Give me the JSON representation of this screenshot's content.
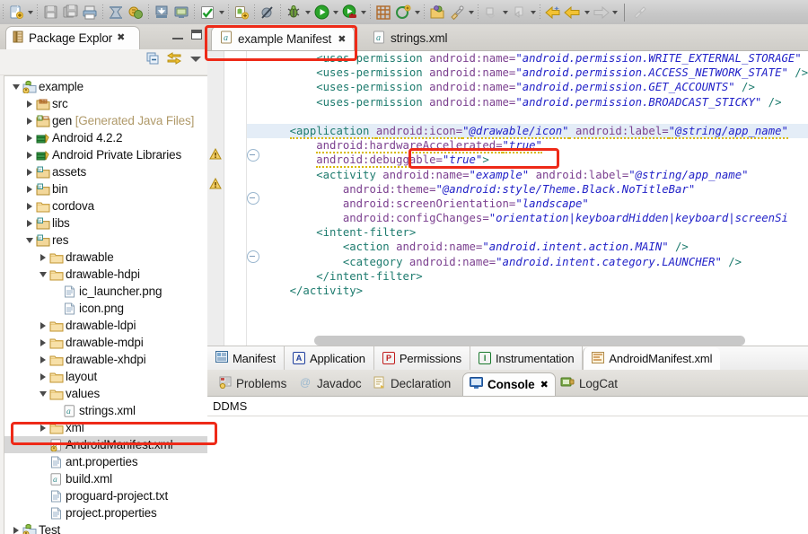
{
  "toolbar": {
    "buttons": [
      {
        "name": "new-wizard-icon",
        "label": "New",
        "dropdown": true
      },
      {
        "name": "save-icon",
        "label": "Save",
        "dropdown": false
      },
      {
        "name": "save-all-icon",
        "label": "Save All",
        "dropdown": false
      },
      {
        "name": "print-icon",
        "label": "Print",
        "dropdown": false
      },
      {
        "name": "android-sdk-manager-icon",
        "label": "Android SDK Manager",
        "dropdown": false
      },
      {
        "name": "android-virtual-device-manager-icon",
        "label": "Android Virtual Device Manager",
        "dropdown": false
      },
      {
        "name": "import-icon",
        "label": "Import",
        "dropdown": false
      },
      {
        "name": "export-icon",
        "label": "Export",
        "dropdown": false
      },
      {
        "name": "check-icon",
        "label": "Toggle Mark Occurrences",
        "dropdown": true
      },
      {
        "name": "new-android-project-icon",
        "label": "New Android Project",
        "dropdown": false
      },
      {
        "name": "skip-breakpoints-icon",
        "label": "Skip All Breakpoints",
        "dropdown": false
      },
      {
        "name": "debug-icon",
        "label": "Debug",
        "dropdown": true
      },
      {
        "name": "run-icon",
        "label": "Run",
        "dropdown": true
      },
      {
        "name": "run-external-tools-icon",
        "label": "External Tools",
        "dropdown": true
      },
      {
        "name": "new-java-package-icon",
        "label": "New Java Package",
        "dropdown": false
      },
      {
        "name": "new-java-class-icon",
        "label": "New Java Class",
        "dropdown": true
      },
      {
        "name": "open-type-icon",
        "label": "Open Type",
        "dropdown": false
      },
      {
        "name": "search-icon",
        "label": "Search",
        "dropdown": true
      },
      {
        "name": "next-annotation-icon",
        "label": "Next Annotation",
        "dropdown": true
      },
      {
        "name": "previous-annotation-icon",
        "label": "Previous Annotation",
        "dropdown": true
      },
      {
        "name": "back-icon",
        "label": "Back",
        "dropdown": false
      },
      {
        "name": "previous-edit-icon",
        "label": "Previous Edit Location",
        "dropdown": true
      },
      {
        "name": "forward-icon",
        "label": "Forward",
        "dropdown": true
      },
      {
        "name": "pin-editor-icon",
        "label": "Pin Editor",
        "dropdown": false
      }
    ]
  },
  "package_explorer": {
    "tab_title": "Package Explor",
    "close_glyph": "✖",
    "view_menu_glyph": "▽",
    "toolbar_icons": [
      "collapse-all-icon",
      "link-with-editor-icon",
      "view-menu-icon"
    ],
    "tree": [
      {
        "label": "example",
        "icon": "android-project-icon",
        "indent": 0,
        "twisty": "down"
      },
      {
        "label": "src",
        "icon": "source-folder-icon",
        "indent": 1,
        "twisty": "right"
      },
      {
        "label": "gen ",
        "icon": "gen-folder-icon",
        "indent": 1,
        "twisty": "right",
        "suffix": "[Generated Java Files]"
      },
      {
        "label": "Android 4.2.2",
        "icon": "library-icon",
        "indent": 1,
        "twisty": "right"
      },
      {
        "label": "Android Private Libraries",
        "icon": "library-icon",
        "indent": 1,
        "twisty": "right"
      },
      {
        "label": "assets",
        "icon": "res-folder-icon",
        "indent": 1,
        "twisty": "right"
      },
      {
        "label": "bin",
        "icon": "res-folder-icon",
        "indent": 1,
        "twisty": "right"
      },
      {
        "label": "cordova",
        "icon": "plain-folder-icon",
        "indent": 1,
        "twisty": "right"
      },
      {
        "label": "libs",
        "icon": "res-folder-icon",
        "indent": 1,
        "twisty": "right"
      },
      {
        "label": "res",
        "icon": "res-folder-icon",
        "indent": 1,
        "twisty": "down"
      },
      {
        "label": "drawable",
        "icon": "plain-folder-icon",
        "indent": 2,
        "twisty": "right"
      },
      {
        "label": "drawable-hdpi",
        "icon": "plain-folder-icon",
        "indent": 2,
        "twisty": "down"
      },
      {
        "label": "ic_launcher.png",
        "icon": "file-icon",
        "indent": 3,
        "twisty": "none"
      },
      {
        "label": "icon.png",
        "icon": "file-icon",
        "indent": 3,
        "twisty": "none"
      },
      {
        "label": "drawable-ldpi",
        "icon": "plain-folder-icon",
        "indent": 2,
        "twisty": "right"
      },
      {
        "label": "drawable-mdpi",
        "icon": "plain-folder-icon",
        "indent": 2,
        "twisty": "right"
      },
      {
        "label": "drawable-xhdpi",
        "icon": "plain-folder-icon",
        "indent": 2,
        "twisty": "right"
      },
      {
        "label": "layout",
        "icon": "plain-folder-icon",
        "indent": 2,
        "twisty": "right"
      },
      {
        "label": "values",
        "icon": "plain-folder-icon",
        "indent": 2,
        "twisty": "down"
      },
      {
        "label": "strings.xml",
        "icon": "xml-file-icon",
        "indent": 3,
        "twisty": "none"
      },
      {
        "label": "xml",
        "icon": "plain-folder-icon",
        "indent": 2,
        "twisty": "right"
      },
      {
        "label": "AndroidManifest.xml",
        "icon": "manifest-file-icon",
        "indent": 2,
        "twisty": "none",
        "selected": true
      },
      {
        "label": "ant.properties",
        "icon": "file-icon",
        "indent": 2,
        "twisty": "none"
      },
      {
        "label": "build.xml",
        "icon": "xml-file-icon",
        "indent": 2,
        "twisty": "none"
      },
      {
        "label": "proguard-project.txt",
        "icon": "file-icon",
        "indent": 2,
        "twisty": "none"
      },
      {
        "label": "project.properties",
        "icon": "file-icon",
        "indent": 2,
        "twisty": "none"
      },
      {
        "label": "Test",
        "icon": "android-project-icon",
        "indent": 0,
        "twisty": "right"
      }
    ]
  },
  "editor": {
    "tabs": [
      {
        "label": "example Manifest",
        "icon": "manifest-file-icon",
        "active": true,
        "close": "✖"
      },
      {
        "label": "strings.xml",
        "icon": "xml-file-icon",
        "active": false
      }
    ],
    "code_lines": [
      {
        "indent": "        ",
        "segments": [
          {
            "t": "<uses-permission ",
            "c": "tag"
          },
          {
            "t": "android:name=",
            "c": "attr"
          },
          {
            "t": "\"android.permission.WRITE_EXTERNAL_STORAGE\"",
            "c": "val"
          },
          {
            "t": " />",
            "c": "pun"
          }
        ]
      },
      {
        "indent": "        ",
        "segments": [
          {
            "t": "<uses-permission ",
            "c": "tag"
          },
          {
            "t": "android:name=",
            "c": "attr"
          },
          {
            "t": "\"android.permission.ACCESS_NETWORK_STATE\"",
            "c": "val"
          },
          {
            "t": " />",
            "c": "pun"
          }
        ]
      },
      {
        "indent": "        ",
        "segments": [
          {
            "t": "<uses-permission ",
            "c": "tag"
          },
          {
            "t": "android:name=",
            "c": "attr"
          },
          {
            "t": "\"android.permission.GET_ACCOUNTS\"",
            "c": "val"
          },
          {
            "t": " />",
            "c": "pun"
          }
        ]
      },
      {
        "indent": "        ",
        "segments": [
          {
            "t": "<uses-permission ",
            "c": "tag"
          },
          {
            "t": "android:name=",
            "c": "attr"
          },
          {
            "t": "\"android.permission.BROADCAST_STICKY\"",
            "c": "val"
          },
          {
            "t": " />",
            "c": "pun"
          }
        ]
      },
      {
        "indent": "",
        "segments": []
      },
      {
        "indent": "    ",
        "highlight": true,
        "segments": [
          {
            "t": "<application ",
            "c": "tag udl"
          },
          {
            "t": "android:icon=",
            "c": "attr udl"
          },
          {
            "t": "\"@drawable/icon\"",
            "c": "val udl"
          },
          {
            "t": " android:label=",
            "c": "attr udl"
          },
          {
            "t": "\"@string/app_name\"",
            "c": "val udl"
          }
        ]
      },
      {
        "indent": "        ",
        "segments": [
          {
            "t": "android:hardwareAccelerated=",
            "c": "attr udl"
          },
          {
            "t": "\"true\"",
            "c": "val udl"
          }
        ]
      },
      {
        "indent": "        ",
        "segments": [
          {
            "t": "android:debuggable=",
            "c": "attr udl"
          },
          {
            "t": "\"true\"",
            "c": "val udl"
          },
          {
            "t": ">",
            "c": "pun"
          }
        ]
      },
      {
        "indent": "        ",
        "segments": [
          {
            "t": "<activity ",
            "c": "tag"
          },
          {
            "t": "android:name=",
            "c": "attr"
          },
          {
            "t": "\"example\"",
            "c": "val"
          },
          {
            "t": " android:label=",
            "c": "attr"
          },
          {
            "t": "\"@string/app_name\"",
            "c": "val"
          }
        ]
      },
      {
        "indent": "            ",
        "segments": [
          {
            "t": "android:theme=",
            "c": "attr"
          },
          {
            "t": "\"@android:style/Theme.Black.NoTitleBar\"",
            "c": "val"
          }
        ]
      },
      {
        "indent": "            ",
        "segments": [
          {
            "t": "android:screenOrientation=",
            "c": "attr"
          },
          {
            "t": "\"landscape\"",
            "c": "val"
          }
        ]
      },
      {
        "indent": "            ",
        "segments": [
          {
            "t": "android:configChanges=",
            "c": "attr"
          },
          {
            "t": "\"orientation|keyboardHidden|keyboard|screenSi",
            "c": "val"
          }
        ]
      },
      {
        "indent": "        ",
        "segments": [
          {
            "t": "<intent-filter>",
            "c": "tag"
          }
        ]
      },
      {
        "indent": "            ",
        "segments": [
          {
            "t": "<action ",
            "c": "tag"
          },
          {
            "t": "android:name=",
            "c": "attr"
          },
          {
            "t": "\"android.intent.action.MAIN\"",
            "c": "val"
          },
          {
            "t": " />",
            "c": "pun"
          }
        ]
      },
      {
        "indent": "            ",
        "segments": [
          {
            "t": "<category ",
            "c": "tag"
          },
          {
            "t": "android:name=",
            "c": "attr"
          },
          {
            "t": "\"android.intent.category.LAUNCHER\"",
            "c": "val"
          },
          {
            "t": " />",
            "c": "pun"
          }
        ]
      },
      {
        "indent": "        ",
        "segments": [
          {
            "t": "</intent-filter>",
            "c": "tag"
          }
        ]
      },
      {
        "indent": "    ",
        "segments": [
          {
            "t": "</activity>",
            "c": "tag"
          }
        ]
      }
    ],
    "sub_tabs": [
      {
        "label": "Manifest",
        "icon": "manifest-form-icon",
        "badge": "",
        "active": false
      },
      {
        "label": "Application",
        "icon": "application-icon",
        "badge": "A",
        "active": false
      },
      {
        "label": "Permissions",
        "icon": "permissions-icon",
        "badge": "P",
        "active": false
      },
      {
        "label": "Instrumentation",
        "icon": "instrumentation-icon",
        "badge": "I",
        "active": false
      },
      {
        "label": "AndroidManifest.xml",
        "icon": "xml-source-icon",
        "badge": "",
        "active": true
      }
    ]
  },
  "bottom_panel": {
    "tabs": [
      {
        "label": "Problems",
        "icon": "problems-icon",
        "active": false
      },
      {
        "label": "Javadoc",
        "icon": "javadoc-icon",
        "active": false
      },
      {
        "label": "Declaration",
        "icon": "declaration-icon",
        "active": false
      },
      {
        "label": "Console",
        "icon": "console-icon",
        "active": true,
        "close": "✖"
      },
      {
        "label": "LogCat",
        "icon": "logcat-icon",
        "active": false
      }
    ],
    "console_text": "DDMS"
  },
  "annotations": {
    "color": "#ee2a18",
    "boxes": [
      "editor-tab-highlight",
      "manifest-icon-attribute-highlight",
      "androidmanifest-file-highlight"
    ]
  }
}
